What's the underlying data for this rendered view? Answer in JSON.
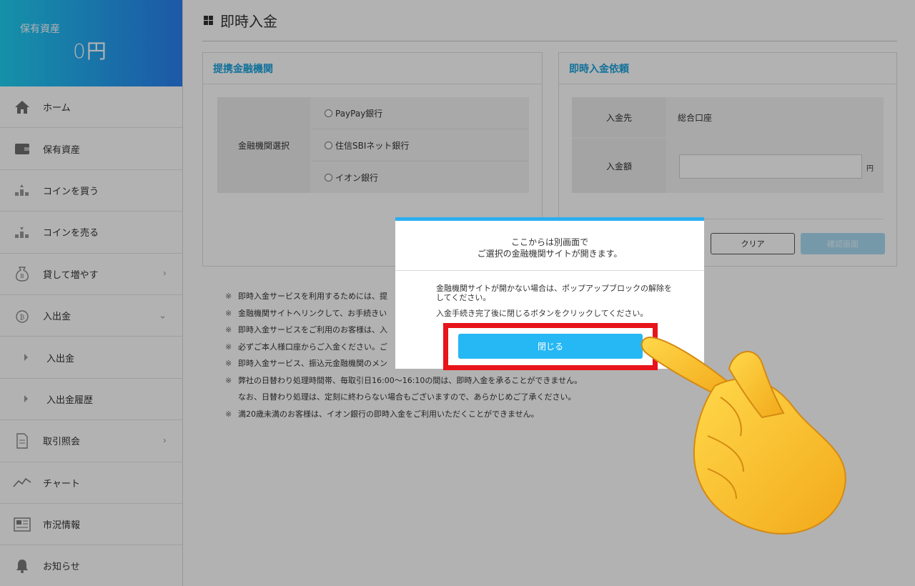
{
  "sidebar": {
    "asset_label": "保有資産",
    "asset_value": "0円",
    "items": [
      {
        "label": "ホーム",
        "icon": "home-icon"
      },
      {
        "label": "保有資産",
        "icon": "wallet-icon"
      },
      {
        "label": "コインを買う",
        "icon": "coin-buy-icon"
      },
      {
        "label": "コインを売る",
        "icon": "coin-sell-icon"
      },
      {
        "label": "貸して増やす",
        "icon": "moneybag-icon",
        "chevron": "›"
      },
      {
        "label": "入出金",
        "icon": "deposit-coin-icon",
        "chevron": "⌄"
      },
      {
        "label": "入出金"
      },
      {
        "label": "入出金履歴"
      },
      {
        "label": "取引照会",
        "icon": "document-icon",
        "chevron": "›"
      },
      {
        "label": "チャート",
        "icon": "chart-line-icon"
      },
      {
        "label": "市況情報",
        "icon": "newspaper-icon"
      },
      {
        "label": "お知らせ",
        "icon": "bell-icon"
      }
    ]
  },
  "main": {
    "title": "即時入金",
    "affiliate_panel": {
      "heading": "提携金融機関",
      "select_label": "金融機関選択",
      "options": [
        "PayPay銀行",
        "住信SBIネット銀行",
        "イオン銀行"
      ]
    },
    "request_panel": {
      "heading": "即時入金依頼",
      "dest_label": "入金先",
      "dest_value": "総合口座",
      "amount_label": "入金額",
      "amount_value": "",
      "yen_unit": "円",
      "clear_button": "クリア",
      "confirm_button": "確認画面"
    },
    "notes": [
      {
        "mark": "※",
        "text": "即時入金サービスを利用するためには、提"
      },
      {
        "mark": "※",
        "text": "金融機関サイトへリンクして、お手続きい"
      },
      {
        "mark": "※",
        "text": "即時入金サービスをご利用のお客様は、入"
      },
      {
        "mark": "※",
        "text": "必ずご本人様口座からご入金ください。ご"
      },
      {
        "mark": "※",
        "text": "即時入金サービス、振込元金融機関のメン"
      },
      {
        "mark": "※",
        "text": "弊社の日替わり処理時間帯、毎取引日16:00〜16:10の間は、即時入金を承ることができません。"
      },
      {
        "mark": "",
        "text": "なお、日替わり処理は、定刻に終わらない場合もございますので、あらかじめご了承ください。"
      },
      {
        "mark": "※",
        "text": "満20歳未満のお客様は、イオン銀行の即時入金をご利用いただくことができません。"
      }
    ]
  },
  "modal": {
    "title_line1": "ここからは別画面で",
    "title_line2": "ご選択の金融機関サイトが開きます。",
    "body_line1": "金融機関サイトが開かない場合は、ポップアップブロックの解除をしてください。",
    "body_line2": "入金手続き完了後に閉じるボタンをクリックしてください。",
    "close_button": "閉じる"
  },
  "colors": {
    "accent": "#1aa3dd",
    "button_blue": "#26b7f5",
    "highlight_red": "#e8141b",
    "gradient_start": "#1fd0f3",
    "gradient_end": "#2a7ff0"
  }
}
